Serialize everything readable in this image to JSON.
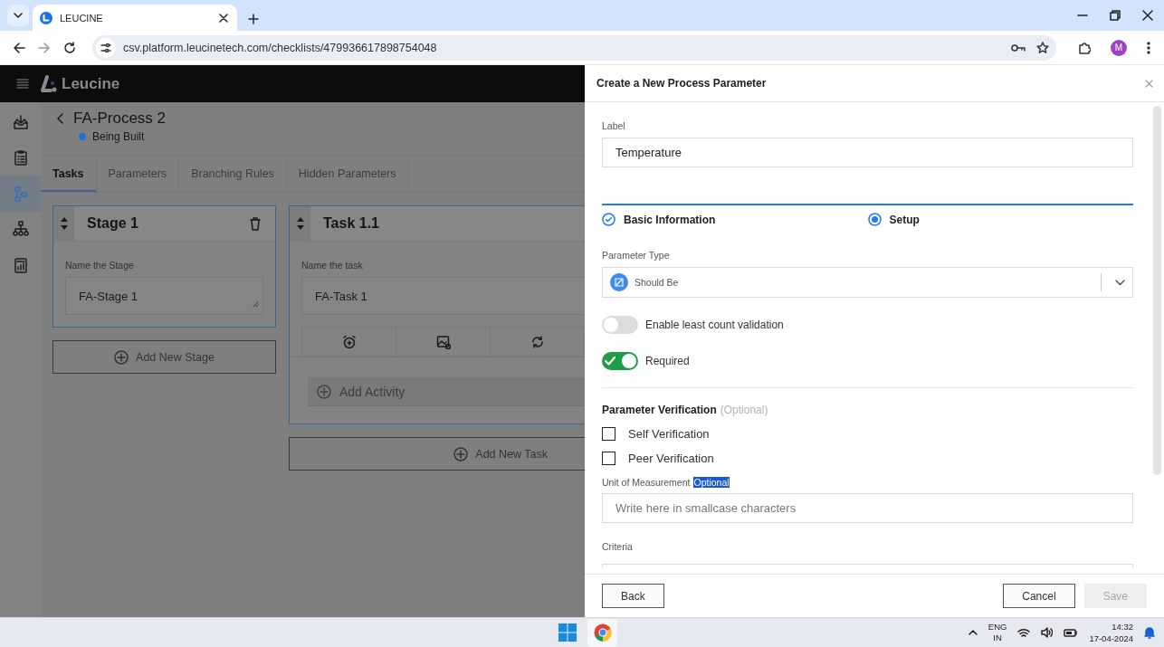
{
  "browser": {
    "tab": {
      "title": "LEUCINE"
    },
    "url": "csv.platform.leucinetech.com/checklists/479936617898754048",
    "profile": "M"
  },
  "app": {
    "logo": "Leucine",
    "sidebar": {
      "items": [
        {
          "kind": "inbox",
          "selected": false
        },
        {
          "kind": "checklist",
          "selected": false
        },
        {
          "kind": "process",
          "selected": true
        },
        {
          "kind": "hierarchy",
          "selected": false
        },
        {
          "kind": "report",
          "selected": false
        }
      ]
    },
    "process": {
      "title": "FA-Process 2",
      "status": {
        "text": "Being Built",
        "color": "#1f6fd8"
      }
    },
    "tabs": [
      {
        "label": "Tasks",
        "selected": true
      },
      {
        "label": "Parameters",
        "selected": false
      },
      {
        "label": "Branching Rules",
        "selected": false
      },
      {
        "label": "Hidden Parameters",
        "selected": false
      }
    ],
    "stage": {
      "title": "Stage 1",
      "field_label": "Name the Stage",
      "value": "FA-Stage 1",
      "add_button": "Add New Stage"
    },
    "task": {
      "title": "Task 1.1",
      "field_label": "Name the task",
      "value": "FA-Task 1",
      "tools": [
        {
          "kind": "timer"
        },
        {
          "kind": "media"
        },
        {
          "kind": "recurrence"
        }
      ],
      "add_activity": "Add Activity",
      "add_button": "Add New Task"
    }
  },
  "drawer": {
    "title": "Create a New Process Parameter",
    "label_field": {
      "label": "Label",
      "value": "Temperature"
    },
    "steps": [
      {
        "label": "Basic Information",
        "done": true,
        "current": false
      },
      {
        "label": "Setup",
        "done": false,
        "current": true
      }
    ],
    "parameter_type": {
      "label": "Parameter Type",
      "value": "Should Be"
    },
    "toggles": [
      {
        "label": "Enable least count validation",
        "on": false
      },
      {
        "label": "Required",
        "on": true
      }
    ],
    "verification": {
      "heading": "Parameter Verification",
      "note": "(Optional)",
      "options": [
        {
          "label": "Self Verification",
          "checked": false
        },
        {
          "label": "Peer Verification",
          "checked": false
        }
      ]
    },
    "unit_field": {
      "label": "Unit of Measurement",
      "tag": "Optional",
      "highlighted": true,
      "placeholder": "Write here in smallcase characters"
    },
    "criteria": {
      "label": "Criteria"
    },
    "buttons": [
      {
        "label": "Back",
        "disabled": false
      },
      {
        "label": "Cancel",
        "disabled": false
      },
      {
        "label": "Save",
        "disabled": true
      }
    ]
  },
  "taskbar": {
    "apps": [
      {
        "kind": "start",
        "selected": false
      },
      {
        "kind": "browser",
        "selected": true
      }
    ],
    "language": {
      "code": "ENG",
      "region": "IN"
    },
    "time": "14:32",
    "date": "17-04-2024"
  }
}
